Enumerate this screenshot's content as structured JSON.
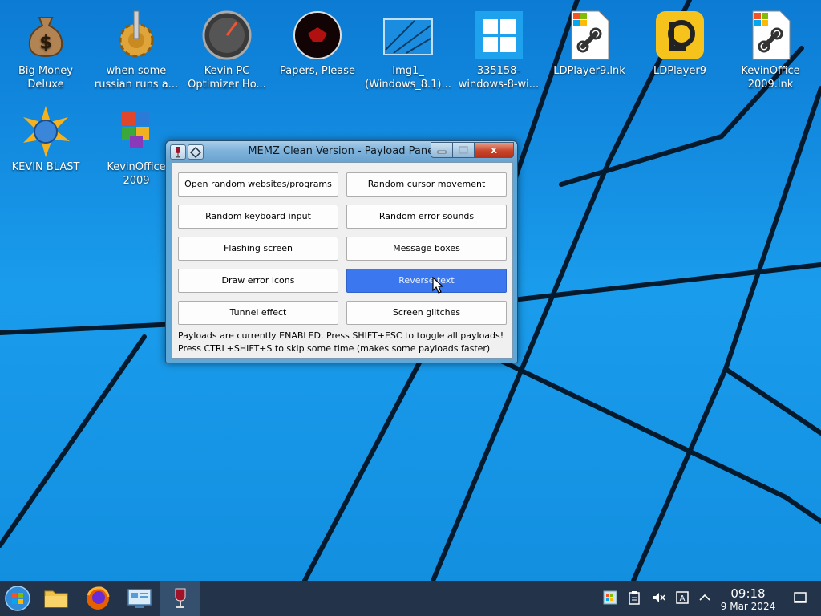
{
  "desktop": {
    "icons": [
      {
        "label": "Big Money\nDeluxe",
        "icon": "money-bag-icon"
      },
      {
        "label": "when some\nrussian runs a...",
        "icon": "gear-icon"
      },
      {
        "label": "Kevin PC\nOptimizer Ho...",
        "icon": "speedometer-icon"
      },
      {
        "label": "Papers, Please",
        "icon": "papers-please-icon"
      },
      {
        "label": "Img1_\n(Windows_8.1)...",
        "icon": "image-file-icon"
      },
      {
        "label": "335158-\nwindows-8-wi...",
        "icon": "windows-logo-icon"
      },
      {
        "label": "LDPlayer9.lnk",
        "icon": "shortcut-file-icon"
      },
      {
        "label": "LDPlayer9",
        "icon": "ldplayer-icon"
      },
      {
        "label": "KevinOffice\n2009.lnk",
        "icon": "shortcut-file-icon"
      },
      {
        "label": "KEVIN BLAST",
        "icon": "kevin-blast-icon"
      },
      {
        "label": "KevinOffice\n2009",
        "icon": "office-icon"
      }
    ]
  },
  "window": {
    "title": "MEMZ Clean Version - Payload Panel",
    "close_label": "x",
    "buttons": [
      {
        "label": "Open random websites/programs",
        "active": false
      },
      {
        "label": "Random cursor movement",
        "active": false
      },
      {
        "label": "Random keyboard input",
        "active": false
      },
      {
        "label": "Random error sounds",
        "active": false
      },
      {
        "label": "Flashing screen",
        "active": false
      },
      {
        "label": "Message boxes",
        "active": false
      },
      {
        "label": "Draw error icons",
        "active": false
      },
      {
        "label": "Reverse text",
        "active": true
      },
      {
        "label": "Tunnel effect",
        "active": false
      },
      {
        "label": "Screen glitches",
        "active": false
      }
    ],
    "status_line1": "Payloads are currently ENABLED. Press SHIFT+ESC to toggle all payloads!",
    "status_line2": "Press CTRL+SHIFT+S to skip some time (makes some payloads faster)"
  },
  "taskbar": {
    "apps": [
      "start-orb-icon",
      "file-manager-icon",
      "firefox-icon",
      "remote-desktop-icon",
      "wine-glass-icon"
    ],
    "tray": [
      "windows-update-icon",
      "clipboard-icon",
      "volume-muted-icon",
      "keyboard-layout-icon",
      "chevron-up-icon",
      "show-desktop-icon"
    ],
    "clock_time": "09:18",
    "clock_date": "9 Mar 2024"
  },
  "colors": {
    "desktop_blue": "#1a9aea",
    "active_button": "#3b78f0",
    "taskbar": "#23344a"
  }
}
